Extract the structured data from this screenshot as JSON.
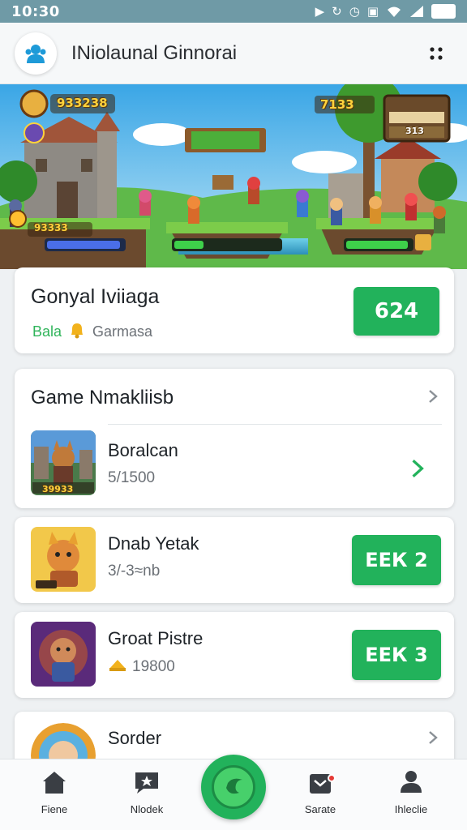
{
  "status_bar": {
    "time": "10:30"
  },
  "header": {
    "title": "INiolaunal Ginnorai",
    "logo_icon": "user-group-icon",
    "menu_icon": "more-dots-icon"
  },
  "banner": {
    "coins_top": "933238",
    "coins_small": "93333",
    "right_counter": "7133",
    "panel_value": "313"
  },
  "profile": {
    "name": "Gonyal Iviiaga",
    "level_label": "Bala",
    "subtitle": "Garmasa",
    "button_label": "624"
  },
  "list": {
    "header": "Game Nmakliisb",
    "items": [
      {
        "title": "Boralcan",
        "subtitle": "5/1500",
        "action": "chevron",
        "thumb_caption": "39933"
      },
      {
        "title": "Dnab Yetak",
        "subtitle": "3/-3≈nb",
        "action_label": "ЕЕК 2"
      },
      {
        "title": "Groat Pistre",
        "subtitle": "19800",
        "action_label": "ЕЕК 3"
      },
      {
        "title": "Sorder",
        "subtitle": ""
      }
    ]
  },
  "nav": {
    "items": [
      {
        "label": "Fiene",
        "icon": "home-icon"
      },
      {
        "label": "Nlodek",
        "icon": "star-chat-icon"
      },
      {
        "label": "",
        "icon": "play-center-icon"
      },
      {
        "label": "Sarate",
        "icon": "bag-icon"
      },
      {
        "label": "Ihleclie",
        "icon": "profile-icon"
      }
    ]
  },
  "colors": {
    "accent": "#22b25b",
    "status_bar": "#6f9aa6",
    "level_text": "#2fb45a"
  }
}
